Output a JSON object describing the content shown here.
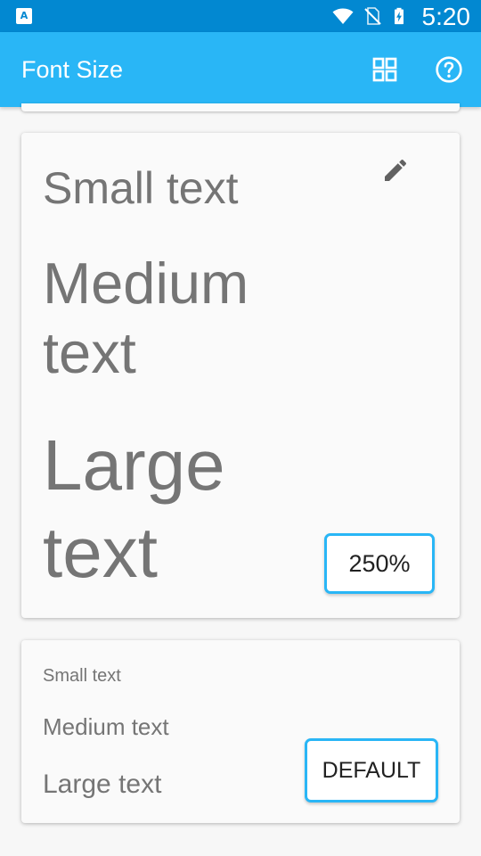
{
  "status_bar": {
    "time": "5:20",
    "app_badge": "A",
    "icons": [
      "wifi-icon",
      "no-sim-icon",
      "battery-charging-icon"
    ]
  },
  "app_bar": {
    "title": "Font Size",
    "actions": [
      "grid-view-icon",
      "help-icon"
    ],
    "background": "#29b6f6"
  },
  "preview_card": {
    "small_text": "Small text",
    "medium_text": "Medium text",
    "large_text": "Large text",
    "scale_label": "250%",
    "edit_icon": "pencil-icon"
  },
  "default_card": {
    "small_text": "Small text",
    "medium_text": "Medium text",
    "large_text": "Large text",
    "button_label": "DEFAULT"
  },
  "colors": {
    "status_bar": "#0288d1",
    "accent": "#29b6f6",
    "text_secondary": "#757575"
  }
}
